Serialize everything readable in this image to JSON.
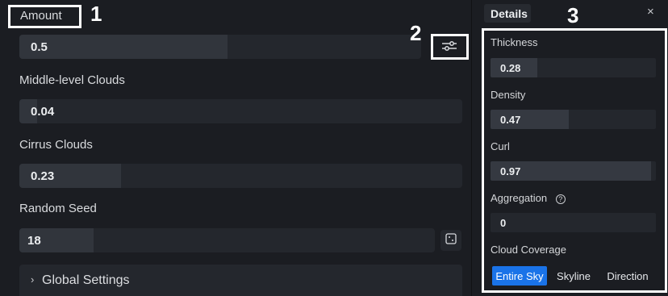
{
  "main": {
    "amount": {
      "label": "Amount",
      "value": "0.5",
      "level": 0.5
    },
    "middle_clouds": {
      "label": "Middle-level Clouds",
      "value": "0.04",
      "level": 0.04
    },
    "cirrus_clouds": {
      "label": "Cirrus Clouds",
      "value": "0.23",
      "level": 0.23
    },
    "random_seed": {
      "label": "Random Seed",
      "value": "18",
      "level": 0.18
    },
    "global_settings": {
      "label": "Global Settings"
    }
  },
  "details": {
    "tab_label": "Details",
    "close_icon": "×",
    "thickness": {
      "label": "Thickness",
      "value": "0.28",
      "level": 0.28
    },
    "density": {
      "label": "Density",
      "value": "0.47",
      "level": 0.47
    },
    "curl": {
      "label": "Curl",
      "value": "0.97",
      "level": 0.97
    },
    "aggregation": {
      "label": "Aggregation",
      "value": "0",
      "level": 0
    },
    "cloud_coverage": {
      "label": "Cloud Coverage",
      "options": [
        "Entire Sky",
        "Skyline",
        "Direction"
      ],
      "selected": "Entire Sky"
    }
  },
  "annotations": [
    "1",
    "2",
    "3"
  ],
  "colors": {
    "accent": "#1a73e8",
    "background": "#1b1d22",
    "field": "#24272d"
  }
}
